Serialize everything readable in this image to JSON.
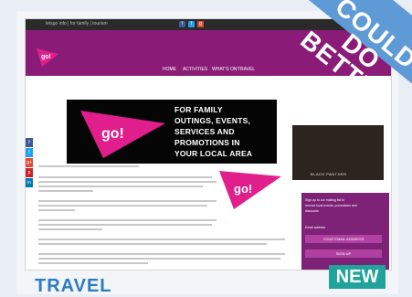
{
  "site": {
    "topbar_title": "letsgo  info | for family | tourism",
    "social_top": [
      "f",
      "t",
      "g"
    ],
    "nav": [
      "HOME",
      "ACTIVITIES",
      "WHAT'S ON",
      "TRAVEL"
    ],
    "hero_lines": [
      "FOR FAMILY",
      "OUTINGS, EVENTS,",
      "SERVICES AND",
      "PROMOTIONS IN",
      "YOUR LOCAL AREA"
    ],
    "side_social": [
      "f",
      "t",
      "g+",
      "p",
      "in"
    ],
    "thumb_caption": "BLACK PANTHER",
    "signup": {
      "line1": "Sign up to our mailing list to",
      "line2": "receive local events, promotions and",
      "line3": "discounts",
      "label": "Email address",
      "field": "YOUR EMAIL ADDRESS",
      "button": "SIGN UP"
    }
  },
  "banner": "COULD DO BETTER",
  "badge": "NEW",
  "section_title": "TRAVEL",
  "colors": {
    "brand": "#8a1c77",
    "banner": "#5d9ad6",
    "badge": "#1fa39a",
    "title": "#2a7bc4"
  }
}
